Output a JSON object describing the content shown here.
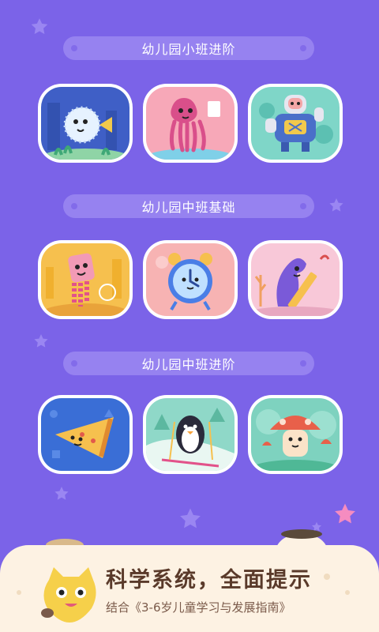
{
  "sections": [
    {
      "title": "幼儿园小班进阶",
      "cards": [
        {
          "name": "pufferfish-lesson-card",
          "icon": "pufferfish"
        },
        {
          "name": "octopus-lesson-card",
          "icon": "octopus"
        },
        {
          "name": "robot-lesson-card",
          "icon": "robot"
        }
      ]
    },
    {
      "title": "幼儿园中班基础",
      "cards": [
        {
          "name": "jellyfish-lesson-card",
          "icon": "jellyfish"
        },
        {
          "name": "alarm-clock-lesson-card",
          "icon": "alarm-clock"
        },
        {
          "name": "dinosaur-ruler-lesson-card",
          "icon": "dinosaur-ruler"
        }
      ]
    },
    {
      "title": "幼儿园中班进阶",
      "cards": [
        {
          "name": "pizza-lesson-card",
          "icon": "pizza-slice"
        },
        {
          "name": "penguin-lesson-card",
          "icon": "skiing-penguin"
        },
        {
          "name": "mushroom-lesson-card",
          "icon": "mushroom"
        }
      ]
    }
  ],
  "footer": {
    "headline": "科学系统，全面提示",
    "subline": "结合《3-6岁儿童学习与发展指南》"
  },
  "colors": {
    "background": "#7b63e8",
    "banner": "#9682f0",
    "footer_panel": "#fdf2e3",
    "headline": "#5a3a2a"
  }
}
